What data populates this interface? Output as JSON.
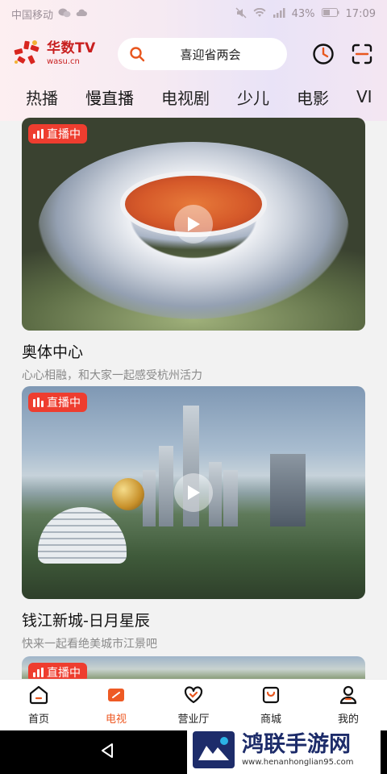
{
  "status_bar": {
    "carrier": "中国移动",
    "battery": "43%",
    "time": "17:09"
  },
  "brand": {
    "name": "华数TV",
    "domain": "wasu.cn",
    "primary_color": "#c81f1f",
    "accent_color": "#ee5a24"
  },
  "search": {
    "placeholder": "喜迎省两会"
  },
  "header_icons": [
    "history-clock-icon",
    "scan-icon"
  ],
  "tabs": [
    {
      "label": "热播"
    },
    {
      "label": "慢直播",
      "active": true
    },
    {
      "label": "电视剧"
    },
    {
      "label": "少儿"
    },
    {
      "label": "电影"
    },
    {
      "label": "VI"
    }
  ],
  "cards": [
    {
      "badge": "直播中",
      "title": "奥体中心",
      "subtitle": "心心相融，和大家一起感受杭州活力"
    },
    {
      "badge": "直播中",
      "title": "钱江新城-日月星辰",
      "subtitle": "快来一起看绝美城市江景吧"
    },
    {
      "badge": "直播中"
    }
  ],
  "bottom_nav": [
    {
      "label": "首页",
      "icon": "home-icon"
    },
    {
      "label": "电视",
      "icon": "tv-icon",
      "active": true
    },
    {
      "label": "营业厅",
      "icon": "heart-icon"
    },
    {
      "label": "商城",
      "icon": "shop-bag-icon"
    },
    {
      "label": "我的",
      "icon": "user-icon"
    }
  ],
  "watermark": {
    "name": "鸿联手游网",
    "url": "www.henanhonglian95.com"
  }
}
